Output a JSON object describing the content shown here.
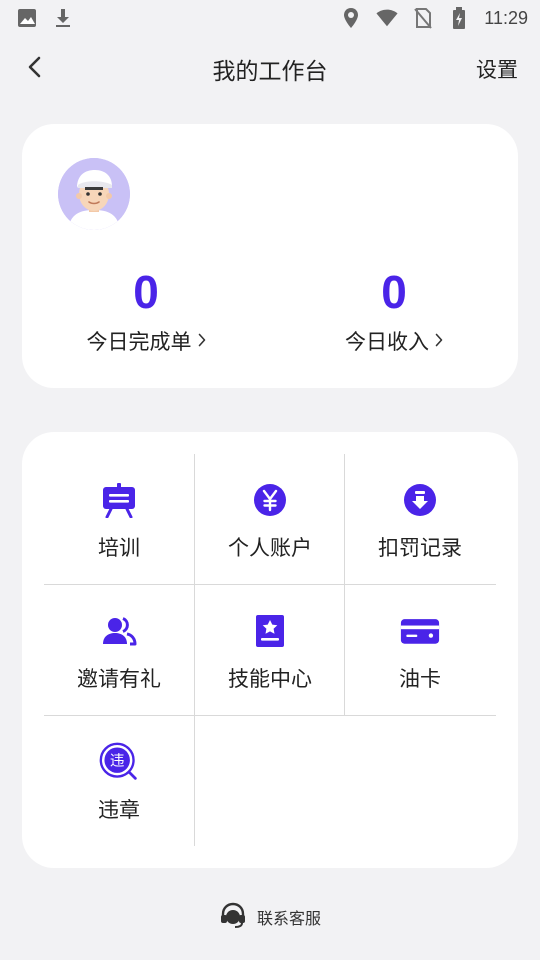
{
  "status_bar": {
    "time": "11:29",
    "left_icons": [
      "image-icon",
      "download-icon"
    ],
    "right_icons": [
      "location-icon",
      "wifi-icon",
      "no-sim-icon",
      "battery-charging-icon"
    ]
  },
  "nav": {
    "title": "我的工作台",
    "settings_label": "设置"
  },
  "profile": {
    "stats": [
      {
        "value": "0",
        "label": "今日完成单"
      },
      {
        "value": "0",
        "label": "今日收入"
      }
    ]
  },
  "menu": {
    "items": [
      {
        "label": "培训",
        "icon": "training-board-icon"
      },
      {
        "label": "个人账户",
        "icon": "yuan-coin-icon"
      },
      {
        "label": "扣罚记录",
        "icon": "penalty-down-icon"
      },
      {
        "label": "邀请有礼",
        "icon": "invite-users-icon"
      },
      {
        "label": "技能中心",
        "icon": "skill-certificate-icon"
      },
      {
        "label": "油卡",
        "icon": "fuel-card-icon"
      },
      {
        "label": "违章",
        "icon": "violation-search-icon",
        "icon_text": "违"
      }
    ]
  },
  "footer": {
    "service_label": "联系客服"
  },
  "colors": {
    "accent": "#4a24e8",
    "background": "#f2f2f4",
    "card": "#ffffff",
    "avatar_bg": "#c9c1f6"
  }
}
